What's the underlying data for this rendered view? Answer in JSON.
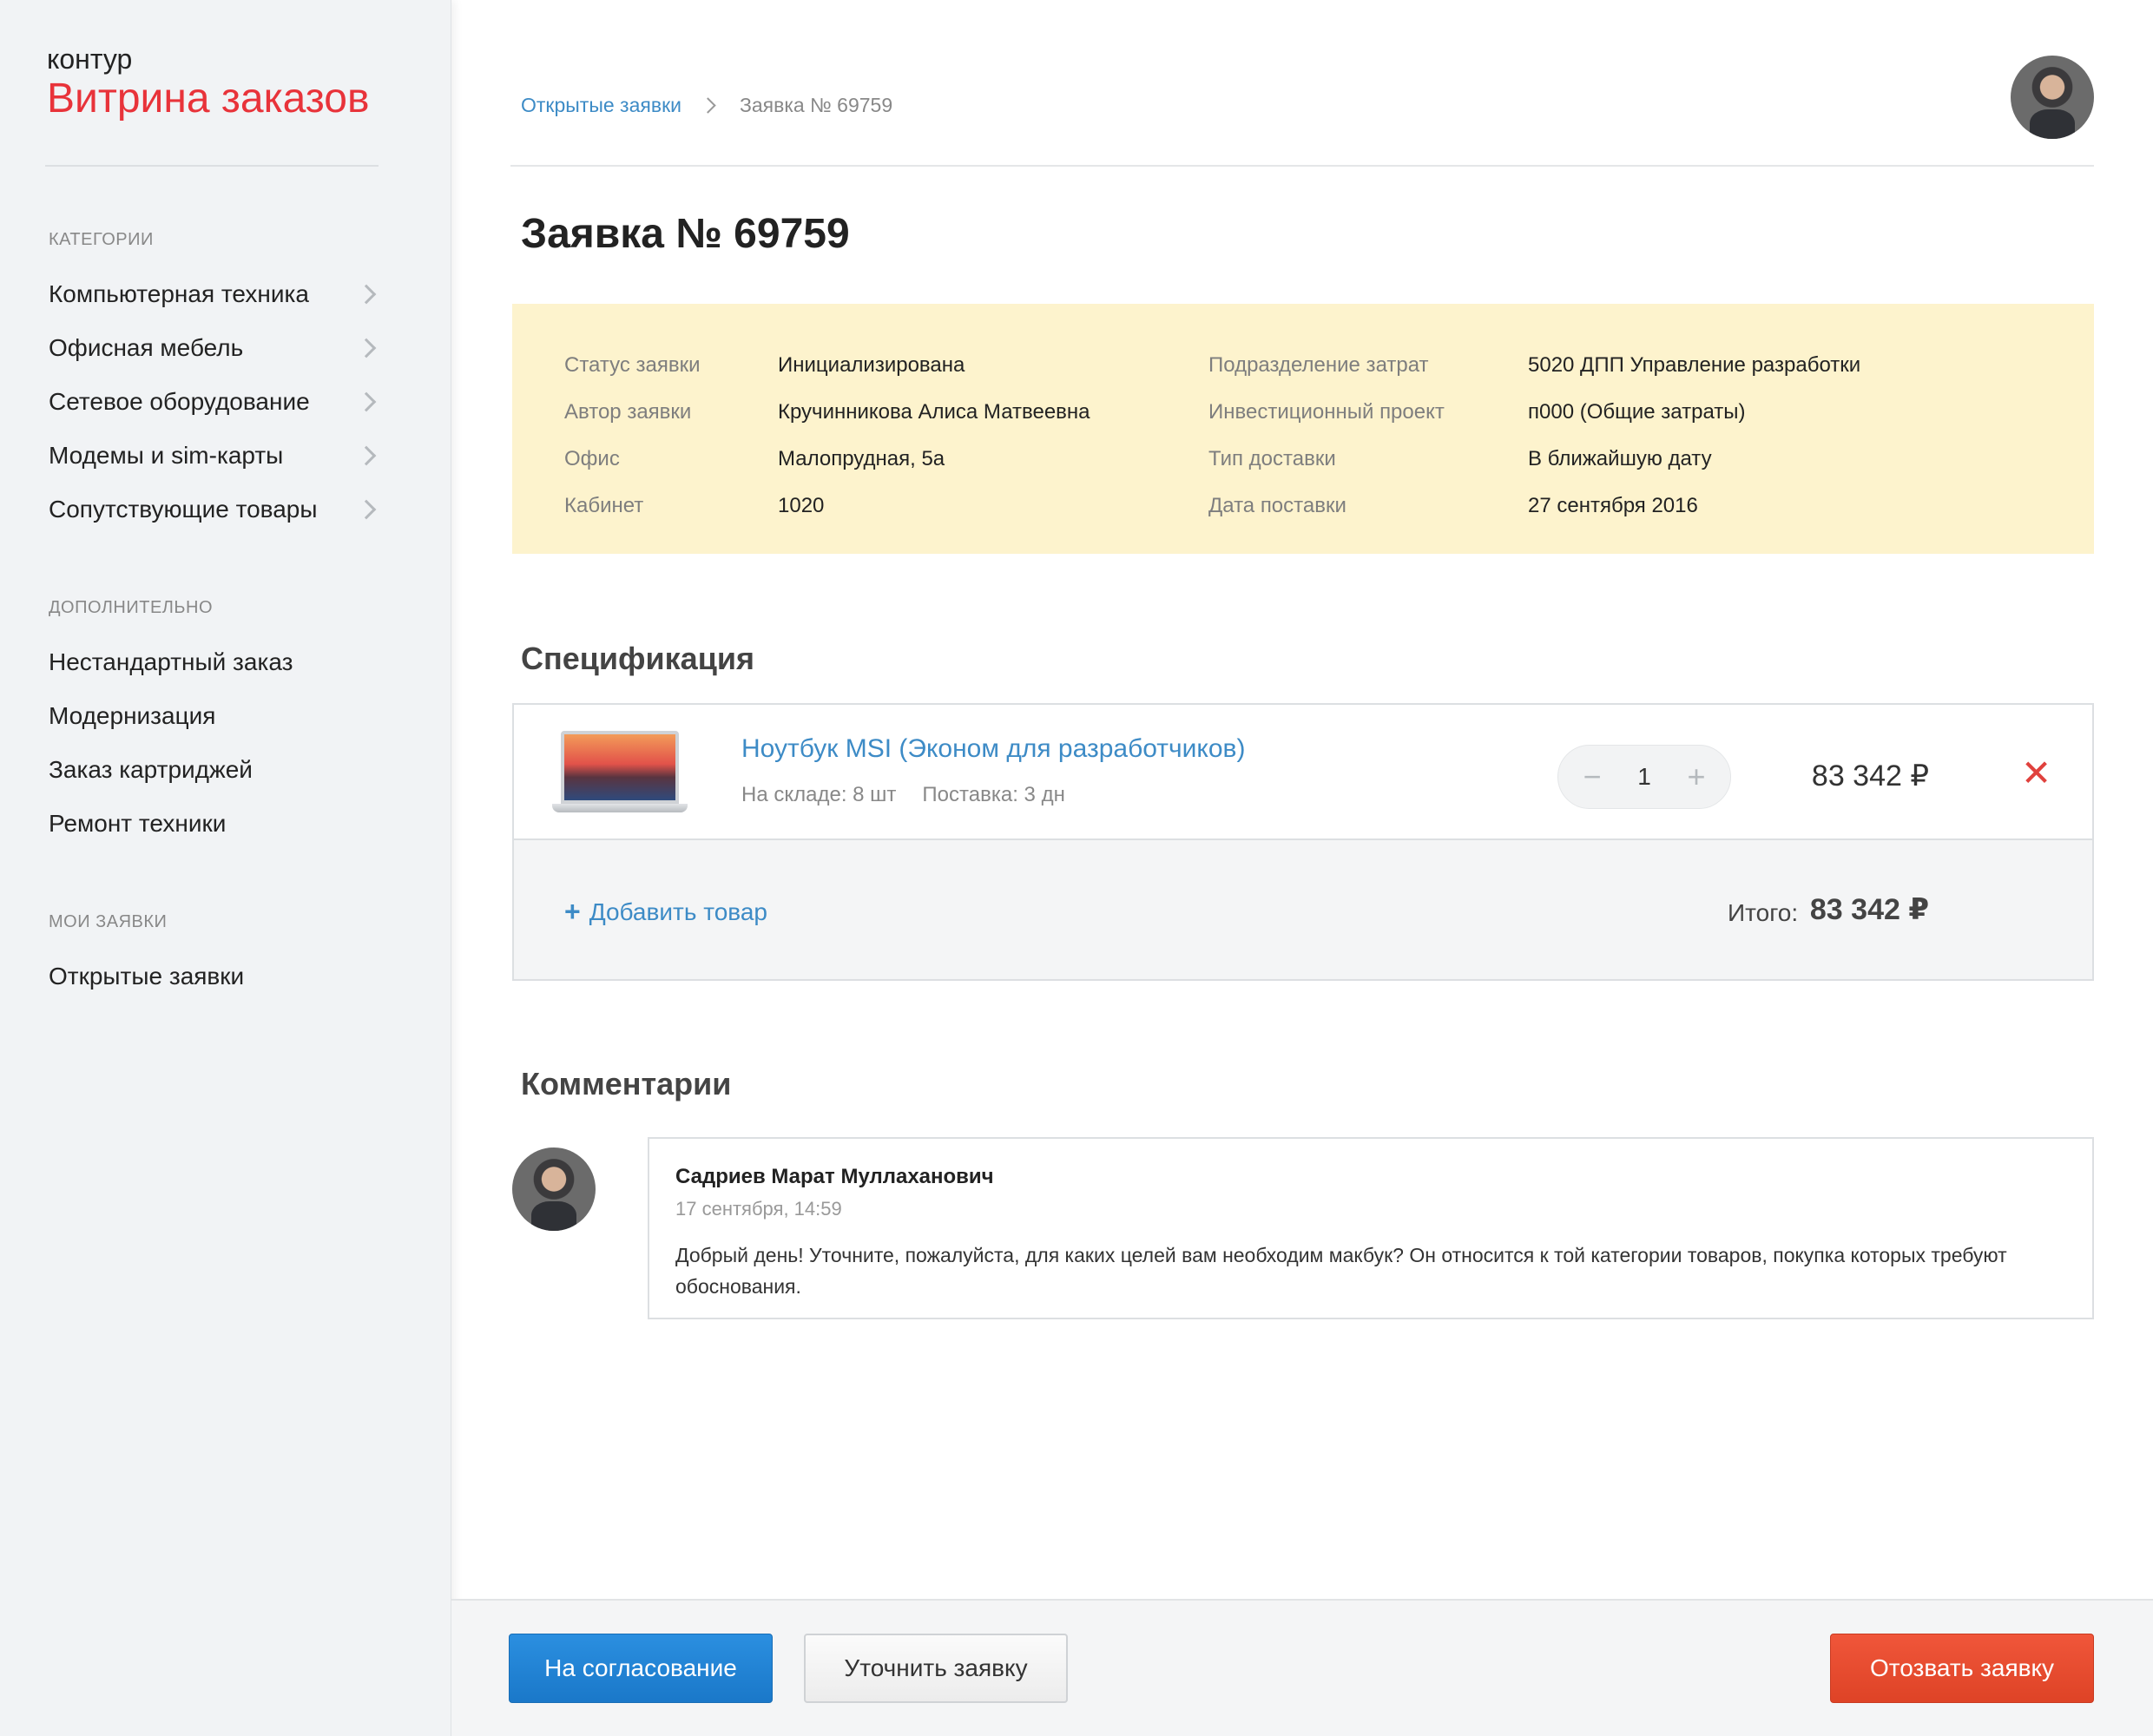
{
  "brand": {
    "small": "контур",
    "big": "Витрина заказов"
  },
  "sidebar": {
    "sections": [
      {
        "heading": "Категории",
        "items": [
          {
            "label": "Компьютерная техника",
            "has_chevron": true
          },
          {
            "label": "Офисная мебель",
            "has_chevron": true
          },
          {
            "label": "Сетевое оборудование",
            "has_chevron": true
          },
          {
            "label": "Модемы и sim-карты",
            "has_chevron": true
          },
          {
            "label": "Сопутствующие товары",
            "has_chevron": true
          }
        ]
      },
      {
        "heading": "Дополнительно",
        "items": [
          {
            "label": "Нестандартный заказ"
          },
          {
            "label": "Модернизация"
          },
          {
            "label": "Заказ картриджей"
          },
          {
            "label": "Ремонт техники"
          }
        ]
      },
      {
        "heading": "Мои заявки",
        "items": [
          {
            "label": "Открытые заявки"
          }
        ]
      }
    ]
  },
  "breadcrumb": {
    "link": "Открытые заявки",
    "current": "Заявка № 69759"
  },
  "page_title": "Заявка № 69759",
  "info": {
    "rows": [
      {
        "label1": "Статус заявки",
        "value1": "Инициализирована",
        "label2": "Подразделение затрат",
        "value2": "5020 ДПП Управление разработки"
      },
      {
        "label1": "Автор заявки",
        "value1": "Кручинникова Алиса Матвеевна",
        "label2": "Инвестиционный проект",
        "value2": "п000 (Общие затраты)"
      },
      {
        "label1": "Офис",
        "value1": "Малопрудная, 5а",
        "label2": "Тип доставки",
        "value2": "В ближайшую дату"
      },
      {
        "label1": "Кабинет",
        "value1": "1020",
        "label2": "Дата поставки",
        "value2": "27 сентября 2016"
      }
    ]
  },
  "spec": {
    "title": "Спецификация",
    "item": {
      "name": "Ноутбук MSI (Эконом для разработчиков)",
      "stock": "На складе: 8 шт",
      "delivery": "Поставка: 3 дн",
      "quantity": "1",
      "minus": "−",
      "plus": "+",
      "price": "83 342 ₽",
      "remove_glyph": "✕"
    },
    "add_plus": "+",
    "add_label": "Добавить товар",
    "total_label": "Итого:",
    "total_value": "83 342 ₽"
  },
  "comments": {
    "title": "Комментарии",
    "items": [
      {
        "author": "Садриев Марат Муллаханович",
        "date": "17 сентября, 14:59",
        "text": "Добрый день! Уточните, пожалуйста, для каких целей вам необходим макбук? Он относится к той категории товаров, покупка которых требуют обоснования."
      }
    ]
  },
  "actions": {
    "approve": "На согласование",
    "clarify": "Уточнить заявку",
    "withdraw": "Отозвать заявку"
  },
  "colors": {
    "brand_red": "#e8333a",
    "link_blue": "#3d8bc6",
    "info_bg": "#fdf3cd",
    "primary_btn": "#1a78c9",
    "danger_btn": "#de4326"
  }
}
